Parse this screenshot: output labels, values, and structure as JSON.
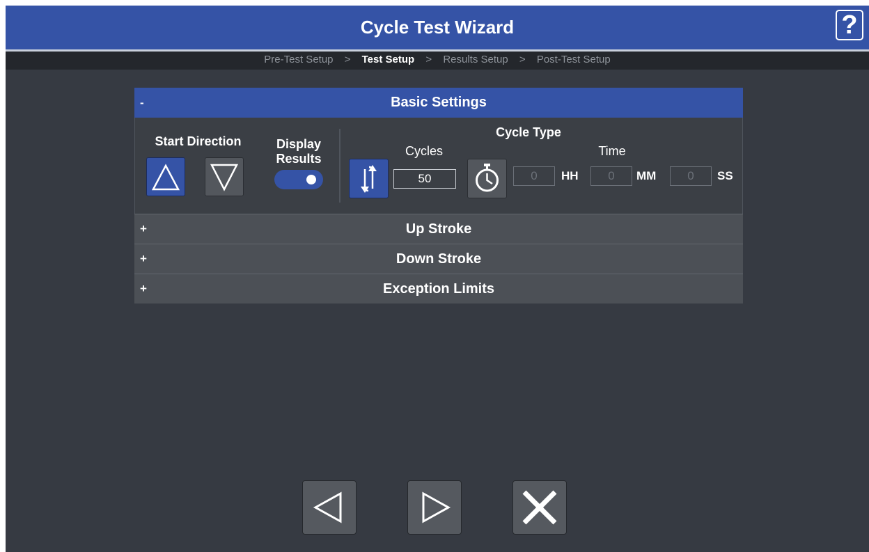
{
  "window": {
    "title": "Cycle Test Wizard",
    "help_label": "?"
  },
  "breadcrumb": {
    "steps": [
      "Pre-Test Setup",
      "Test Setup",
      "Results Setup",
      "Post-Test Setup"
    ],
    "separator": ">",
    "active_index": 1
  },
  "basic_settings": {
    "toggle": "-",
    "title": "Basic Settings",
    "start_direction_label": "Start Direction",
    "display_results_label_1": "Display",
    "display_results_label_2": "Results",
    "display_results_on": true,
    "cycle_type_label": "Cycle Type",
    "cycles_label": "Cycles",
    "cycles_value": "50",
    "time_label": "Time",
    "hh_value": "0",
    "hh_unit": "HH",
    "mm_value": "0",
    "mm_unit": "MM",
    "ss_value": "0",
    "ss_unit": "SS",
    "selected_cycle_type": "cycles",
    "selected_direction": "up"
  },
  "sections": [
    {
      "toggle": "+",
      "title": "Up Stroke"
    },
    {
      "toggle": "+",
      "title": "Down Stroke"
    },
    {
      "toggle": "+",
      "title": "Exception Limits"
    }
  ],
  "icons": {
    "up": "triangle-up-icon",
    "down": "triangle-down-icon",
    "cycles": "cycle-arrows-icon",
    "time": "stopwatch-icon",
    "back": "back-arrow-icon",
    "next": "next-arrow-icon",
    "cancel": "close-icon"
  },
  "colors": {
    "accent": "#3553a6",
    "background": "#363a42",
    "panel": "#3b3f45"
  }
}
